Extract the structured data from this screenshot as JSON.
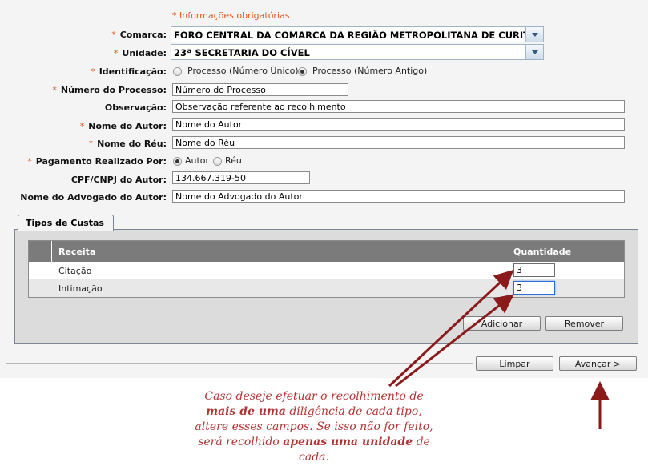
{
  "form": {
    "required_note": "* Informações obrigatórias",
    "required_star": "*",
    "comarca": {
      "label": "Comarca:",
      "value": "FORO CENTRAL DA COMARCA DA REGIÃO METROPOLITANA DE CURITIBA"
    },
    "unidade": {
      "label": "Unidade:",
      "value": "23ª SECRETARIA DO CÍVEL"
    },
    "identificacao": {
      "label": "Identificação:",
      "options": [
        "Processo (Número Único)",
        "Processo (Número Antigo)"
      ],
      "selected": "Processo (Número Antigo)"
    },
    "numero_processo": {
      "label": "Número do Processo:",
      "value": "Número do Processo"
    },
    "observacao": {
      "label": "Observação:",
      "value": "Observação referente ao recolhimento"
    },
    "nome_autor": {
      "label": "Nome do Autor:",
      "value": "Nome do Autor"
    },
    "nome_reu": {
      "label": "Nome do Réu:",
      "value": "Nome do Réu"
    },
    "pagamento": {
      "label": "Pagamento Realizado Por:",
      "options": [
        "Autor",
        "Réu"
      ],
      "selected": "Autor"
    },
    "cpf_autor": {
      "label": "CPF/CNPJ do Autor:",
      "value": "134.667.319-50"
    },
    "advogado_autor": {
      "label": "Nome do Advogado do Autor:",
      "value": "Nome do Advogado do Autor"
    }
  },
  "custas": {
    "tab_label": "Tipos de Custas",
    "columns": [
      "Receita",
      "Quantidade"
    ],
    "rows": [
      {
        "receita": "Citação",
        "quantidade": "3"
      },
      {
        "receita": "Intimação",
        "quantidade": "3"
      }
    ],
    "add_label": "Adicionar",
    "remove_label": "Remover"
  },
  "footer": {
    "clear_label": "Limpar",
    "next_label": "Avançar >"
  },
  "annotation": {
    "p1": "Caso deseje efetuar o recolhimento de",
    "b1": "mais de uma",
    "p2": " diligência de cada tipo,",
    "p3": "altere esses campos. Se isso não for feito,",
    "p4": "será recolhido ",
    "b2": "apenas uma unidade",
    "p5": " de",
    "p6": "cada."
  },
  "colors": {
    "required": "#e05a1e",
    "annotation": "#b33434",
    "grid_header": "#7b7b7b"
  }
}
